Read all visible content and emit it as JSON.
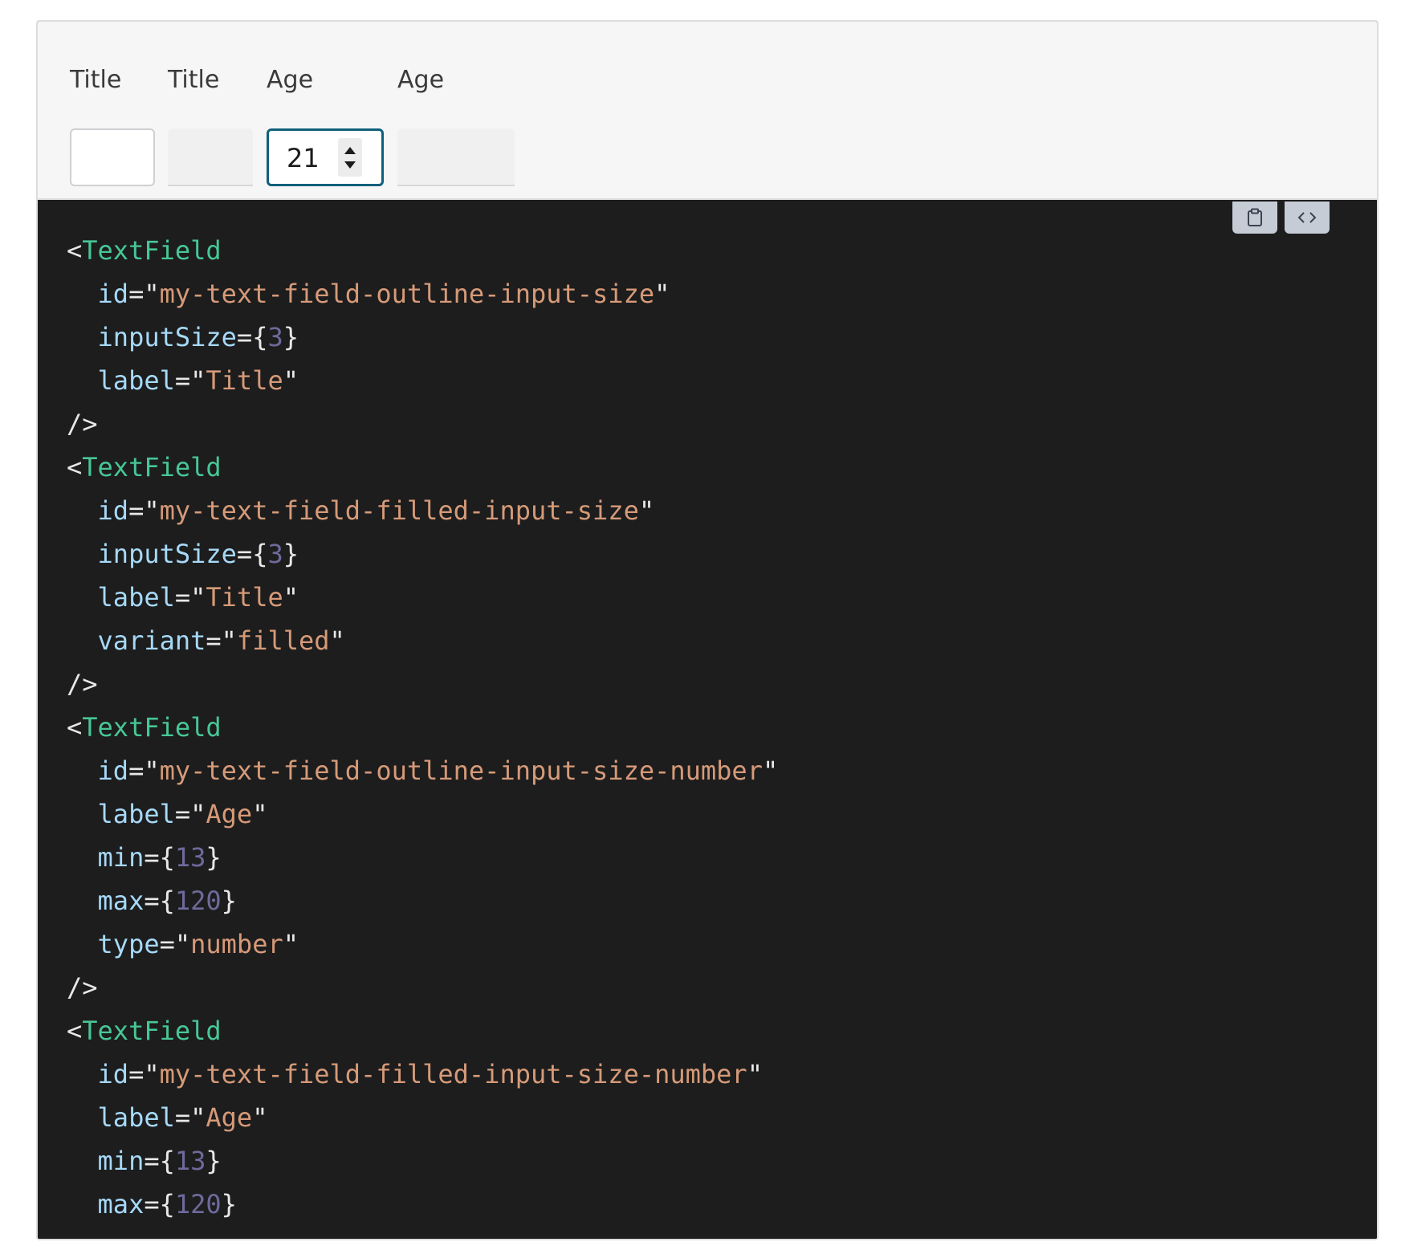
{
  "preview": {
    "fields": [
      {
        "label": "Title",
        "variant": "outline",
        "value": ""
      },
      {
        "label": "Title",
        "variant": "filled",
        "value": ""
      },
      {
        "label": "Age",
        "variant": "outline",
        "type": "number",
        "value": "21",
        "focused": true
      },
      {
        "label": "Age",
        "variant": "filled",
        "type": "number",
        "value": ""
      }
    ]
  },
  "toolbar": {
    "copy_icon": "clipboard-icon",
    "code_icon": "code-brackets-icon"
  },
  "code": {
    "lines": [
      {
        "tokens": [
          {
            "t": "<",
            "c": "punct"
          },
          {
            "t": "TextField",
            "c": "tag"
          }
        ]
      },
      {
        "tokens": [
          {
            "t": "  ",
            "c": "punct"
          },
          {
            "t": "id",
            "c": "attr"
          },
          {
            "t": "=\"",
            "c": "punct"
          },
          {
            "t": "my-text-field-outline-input-size",
            "c": "str"
          },
          {
            "t": "\"",
            "c": "punct"
          }
        ]
      },
      {
        "tokens": [
          {
            "t": "  ",
            "c": "punct"
          },
          {
            "t": "inputSize",
            "c": "attr"
          },
          {
            "t": "={",
            "c": "punct"
          },
          {
            "t": "3",
            "c": "num"
          },
          {
            "t": "}",
            "c": "punct"
          }
        ]
      },
      {
        "tokens": [
          {
            "t": "  ",
            "c": "punct"
          },
          {
            "t": "label",
            "c": "attr"
          },
          {
            "t": "=\"",
            "c": "punct"
          },
          {
            "t": "Title",
            "c": "str"
          },
          {
            "t": "\"",
            "c": "punct"
          }
        ]
      },
      {
        "tokens": [
          {
            "t": "/>",
            "c": "punct"
          }
        ]
      },
      {
        "tokens": [
          {
            "t": "<",
            "c": "punct"
          },
          {
            "t": "TextField",
            "c": "tag"
          }
        ]
      },
      {
        "tokens": [
          {
            "t": "  ",
            "c": "punct"
          },
          {
            "t": "id",
            "c": "attr"
          },
          {
            "t": "=\"",
            "c": "punct"
          },
          {
            "t": "my-text-field-filled-input-size",
            "c": "str"
          },
          {
            "t": "\"",
            "c": "punct"
          }
        ]
      },
      {
        "tokens": [
          {
            "t": "  ",
            "c": "punct"
          },
          {
            "t": "inputSize",
            "c": "attr"
          },
          {
            "t": "={",
            "c": "punct"
          },
          {
            "t": "3",
            "c": "num"
          },
          {
            "t": "}",
            "c": "punct"
          }
        ]
      },
      {
        "tokens": [
          {
            "t": "  ",
            "c": "punct"
          },
          {
            "t": "label",
            "c": "attr"
          },
          {
            "t": "=\"",
            "c": "punct"
          },
          {
            "t": "Title",
            "c": "str"
          },
          {
            "t": "\"",
            "c": "punct"
          }
        ]
      },
      {
        "tokens": [
          {
            "t": "  ",
            "c": "punct"
          },
          {
            "t": "variant",
            "c": "attr"
          },
          {
            "t": "=\"",
            "c": "punct"
          },
          {
            "t": "filled",
            "c": "str"
          },
          {
            "t": "\"",
            "c": "punct"
          }
        ]
      },
      {
        "tokens": [
          {
            "t": "/>",
            "c": "punct"
          }
        ]
      },
      {
        "tokens": [
          {
            "t": "<",
            "c": "punct"
          },
          {
            "t": "TextField",
            "c": "tag"
          }
        ]
      },
      {
        "tokens": [
          {
            "t": "  ",
            "c": "punct"
          },
          {
            "t": "id",
            "c": "attr"
          },
          {
            "t": "=\"",
            "c": "punct"
          },
          {
            "t": "my-text-field-outline-input-size-number",
            "c": "str"
          },
          {
            "t": "\"",
            "c": "punct"
          }
        ]
      },
      {
        "tokens": [
          {
            "t": "  ",
            "c": "punct"
          },
          {
            "t": "label",
            "c": "attr"
          },
          {
            "t": "=\"",
            "c": "punct"
          },
          {
            "t": "Age",
            "c": "str"
          },
          {
            "t": "\"",
            "c": "punct"
          }
        ]
      },
      {
        "tokens": [
          {
            "t": "  ",
            "c": "punct"
          },
          {
            "t": "min",
            "c": "attr"
          },
          {
            "t": "={",
            "c": "punct"
          },
          {
            "t": "13",
            "c": "num"
          },
          {
            "t": "}",
            "c": "punct"
          }
        ]
      },
      {
        "tokens": [
          {
            "t": "  ",
            "c": "punct"
          },
          {
            "t": "max",
            "c": "attr"
          },
          {
            "t": "={",
            "c": "punct"
          },
          {
            "t": "120",
            "c": "num"
          },
          {
            "t": "}",
            "c": "punct"
          }
        ]
      },
      {
        "tokens": [
          {
            "t": "  ",
            "c": "punct"
          },
          {
            "t": "type",
            "c": "attr"
          },
          {
            "t": "=\"",
            "c": "punct"
          },
          {
            "t": "number",
            "c": "str"
          },
          {
            "t": "\"",
            "c": "punct"
          }
        ]
      },
      {
        "tokens": [
          {
            "t": "/>",
            "c": "punct"
          }
        ]
      },
      {
        "tokens": [
          {
            "t": "<",
            "c": "punct"
          },
          {
            "t": "TextField",
            "c": "tag"
          }
        ]
      },
      {
        "tokens": [
          {
            "t": "  ",
            "c": "punct"
          },
          {
            "t": "id",
            "c": "attr"
          },
          {
            "t": "=\"",
            "c": "punct"
          },
          {
            "t": "my-text-field-filled-input-size-number",
            "c": "str"
          },
          {
            "t": "\"",
            "c": "punct"
          }
        ]
      },
      {
        "tokens": [
          {
            "t": "  ",
            "c": "punct"
          },
          {
            "t": "label",
            "c": "attr"
          },
          {
            "t": "=\"",
            "c": "punct"
          },
          {
            "t": "Age",
            "c": "str"
          },
          {
            "t": "\"",
            "c": "punct"
          }
        ]
      },
      {
        "tokens": [
          {
            "t": "  ",
            "c": "punct"
          },
          {
            "t": "min",
            "c": "attr"
          },
          {
            "t": "={",
            "c": "punct"
          },
          {
            "t": "13",
            "c": "num"
          },
          {
            "t": "}",
            "c": "punct"
          }
        ]
      },
      {
        "tokens": [
          {
            "t": "  ",
            "c": "punct"
          },
          {
            "t": "max",
            "c": "attr"
          },
          {
            "t": "={",
            "c": "punct"
          },
          {
            "t": "120",
            "c": "num"
          },
          {
            "t": "}",
            "c": "punct"
          }
        ]
      }
    ]
  },
  "colors": {
    "tag": "#47c796",
    "attr": "#a6d9f7",
    "string": "#d69a78",
    "number": "#6e6a9b",
    "focus_border": "#0f5f7a",
    "code_bg": "#1d1d1e"
  }
}
